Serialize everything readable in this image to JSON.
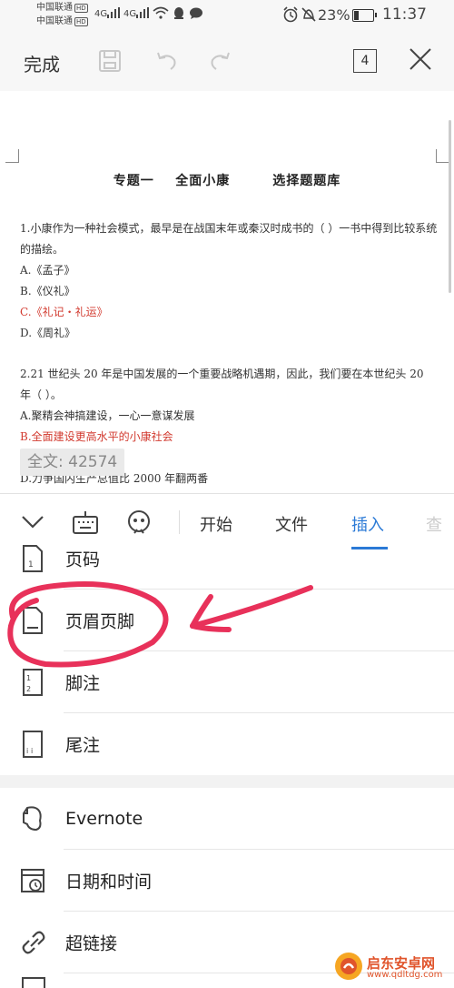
{
  "status_bar": {
    "carrier1": "中国联通",
    "carrier2": "中国联通",
    "hd": "HD",
    "net1": "4G",
    "net2": "4G",
    "battery_pct": "23%",
    "time": "11:37"
  },
  "toolbar": {
    "done_label": "完成",
    "page_count": "4",
    "icons": [
      "save-icon",
      "undo-icon",
      "redo-icon",
      "close-icon"
    ]
  },
  "document": {
    "title": "专题一    全面小康        选择题题库",
    "q1_text": "1.小康作为一种社会模式，最早是在战国末年或秦汉时成书的（ ）一书中得到比较系统的描绘。",
    "q1_a": "A.《孟子》",
    "q1_b": "B.《仪礼》",
    "q1_c": "C.《礼记・礼运》",
    "q1_d": "D.《周礼》",
    "q2_text": "2.21 世纪头 20 年是中国发展的一个重要战略机遇期，因此，我们要在本世纪头 20 年（ ）。",
    "q2_a": "A.聚精会神搞建设，一心一意谋发展",
    "q2_b": "B.全面建设更高水平的小康社会",
    "q2_d": "D.力争国内生产总值比 2000 年翻两番",
    "word_count": "全文: 42574",
    "answer_color": "#d23a2f"
  },
  "tabs": {
    "items": [
      "开始",
      "文件",
      "插入",
      "查"
    ],
    "active": "插入",
    "active_color": "#2b7ad6"
  },
  "menu": {
    "items": [
      "页码",
      "页眉页脚",
      "脚注",
      "尾注",
      "Evernote",
      "日期和时间",
      "超链接"
    ]
  },
  "watermark": {
    "name": "启东安卓网",
    "url": "www.qdltdg.com"
  }
}
